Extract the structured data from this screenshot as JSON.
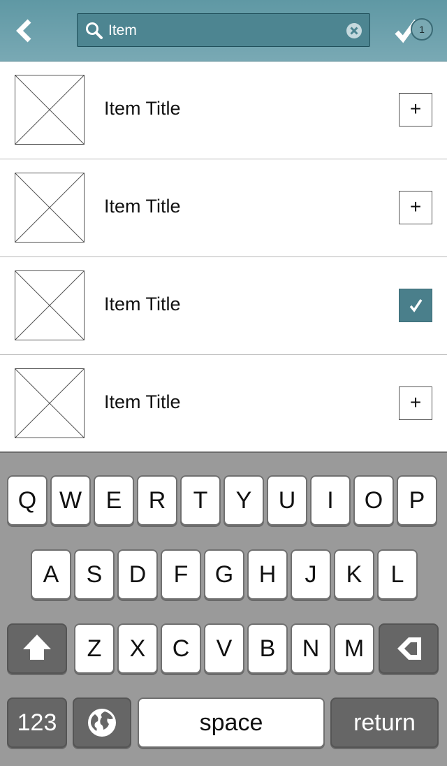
{
  "header": {
    "back_icon": "chevron-left-icon",
    "search": {
      "value": "Item",
      "icon": "search-icon",
      "clear_icon": "clear-circle-icon"
    },
    "done": {
      "icon": "checkmark-icon",
      "count": "1"
    }
  },
  "list": {
    "items": [
      {
        "title": "Item Title",
        "thumbnail": "image-placeholder-icon",
        "action": "+",
        "checked": false
      },
      {
        "title": "Item Title",
        "thumbnail": "image-placeholder-icon",
        "action": "+",
        "checked": false
      },
      {
        "title": "Item Title",
        "thumbnail": "image-placeholder-icon",
        "action": "✓",
        "checked": true
      },
      {
        "title": "Item Title",
        "thumbnail": "image-placeholder-icon",
        "action": "+",
        "checked": false
      }
    ]
  },
  "keyboard": {
    "row1": [
      "Q",
      "W",
      "E",
      "R",
      "T",
      "Y",
      "U",
      "I",
      "O",
      "P"
    ],
    "row2": [
      "A",
      "S",
      "D",
      "F",
      "G",
      "H",
      "J",
      "K",
      "L"
    ],
    "row3": [
      "Z",
      "X",
      "C",
      "V",
      "B",
      "N",
      "M"
    ],
    "shift_icon": "shift-arrow-icon",
    "delete_icon": "backspace-icon",
    "numbers_label": "123",
    "globe_icon": "globe-icon",
    "space_label": "space",
    "return_label": "return"
  },
  "colors": {
    "header": "#6ea2ad",
    "accent": "#4a7f8b",
    "keyboard_bg": "#9a9a9a",
    "dark_key": "#666666"
  }
}
